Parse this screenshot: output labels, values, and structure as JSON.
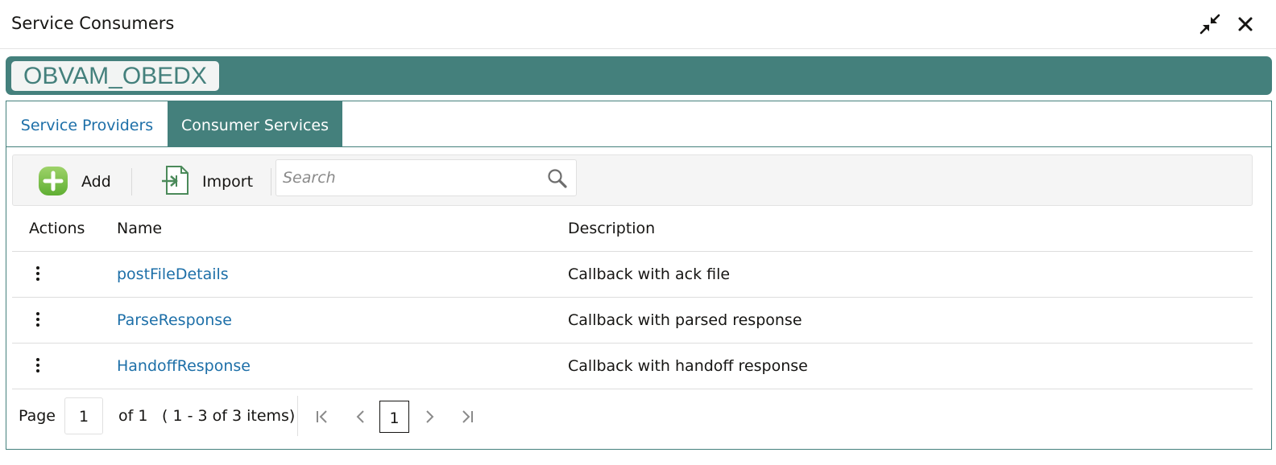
{
  "dialog": {
    "title": "Service Consumers",
    "minimize_icon": "compress-arrows-icon",
    "close_icon": "close-icon"
  },
  "context": {
    "name": "OBVAM_OBEDX",
    "bar_color": "#44807c"
  },
  "tabs": [
    {
      "label": "Service Providers",
      "active": false
    },
    {
      "label": "Consumer Services",
      "active": true
    }
  ],
  "toolbar": {
    "add_label": "Add",
    "add_icon": "plus-circle-icon",
    "import_label": "Import",
    "import_icon": "import-icon",
    "search_placeholder": "Search",
    "search_value": "",
    "search_icon": "magnifier-icon"
  },
  "table": {
    "columns": [
      "Actions",
      "Name",
      "Description"
    ],
    "rows": [
      {
        "name": "postFileDetails",
        "description": "Callback with ack file"
      },
      {
        "name": "ParseResponse",
        "description": "Callback with parsed response"
      },
      {
        "name": "HandoffResponse",
        "description": "Callback with handoff response"
      }
    ]
  },
  "pagination": {
    "page_label": "Page",
    "page_value": "1",
    "of_label": "of 1",
    "items_summary": "( 1 - 3 of 3 items)",
    "current_page": "1"
  },
  "colors": {
    "accent": "#44807c",
    "link": "#1d6fa8",
    "add_green": "#7dc24b"
  }
}
